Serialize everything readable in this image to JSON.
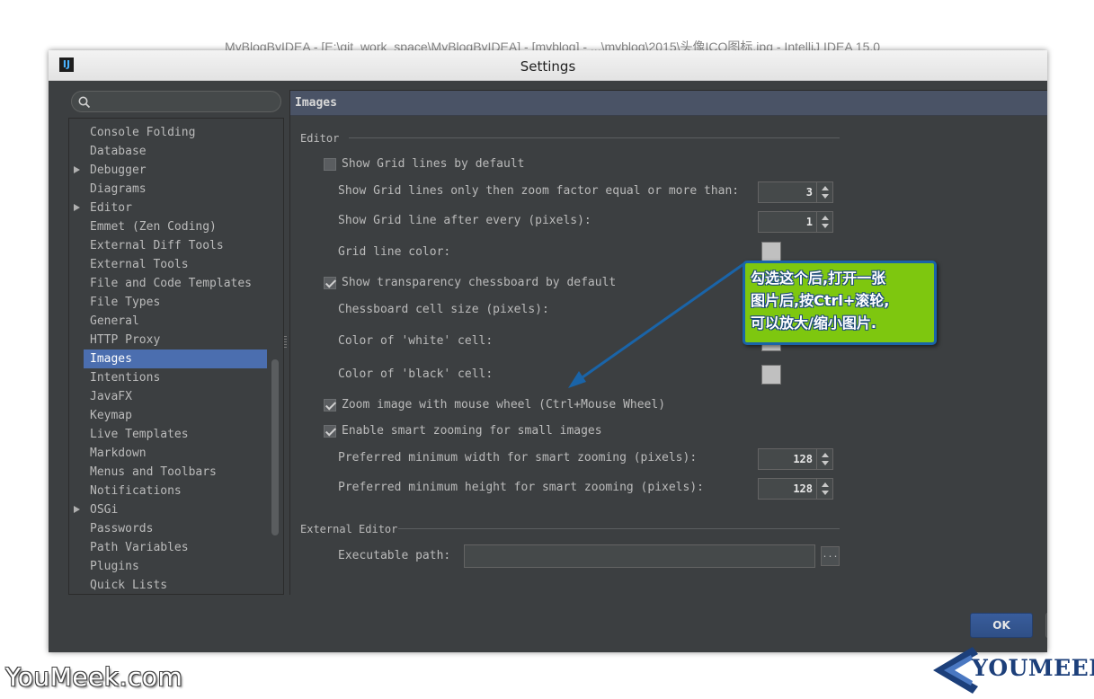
{
  "window_title": "Settings",
  "background_title": "MyBlogByIDEA - [E:\\git_work_space\\MyBlogByIDEA] - [myblog] - ...\\myblog\\2015\\头像ICO图标.jpg - IntelliJ IDEA 15.0",
  "app_icon": "IJ",
  "search": {
    "placeholder": "",
    "icon": "search-icon"
  },
  "sidebar": {
    "items": [
      {
        "label": "Console Folding",
        "expandable": false
      },
      {
        "label": "Database",
        "expandable": false
      },
      {
        "label": "Debugger",
        "expandable": true
      },
      {
        "label": "Diagrams",
        "expandable": false
      },
      {
        "label": "Editor",
        "expandable": true
      },
      {
        "label": "Emmet (Zen Coding)",
        "expandable": false
      },
      {
        "label": "External Diff Tools",
        "expandable": false
      },
      {
        "label": "External Tools",
        "expandable": false
      },
      {
        "label": "File and Code Templates",
        "expandable": false
      },
      {
        "label": "File Types",
        "expandable": false
      },
      {
        "label": "General",
        "expandable": false
      },
      {
        "label": "HTTP Proxy",
        "expandable": false
      },
      {
        "label": "Images",
        "expandable": false,
        "selected": true
      },
      {
        "label": "Intentions",
        "expandable": false
      },
      {
        "label": "JavaFX",
        "expandable": false
      },
      {
        "label": "Keymap",
        "expandable": false
      },
      {
        "label": "Live Templates",
        "expandable": false
      },
      {
        "label": "Markdown",
        "expandable": false
      },
      {
        "label": "Menus and Toolbars",
        "expandable": false
      },
      {
        "label": "Notifications",
        "expandable": false
      },
      {
        "label": "OSGi",
        "expandable": true
      },
      {
        "label": "Passwords",
        "expandable": false
      },
      {
        "label": "Path Variables",
        "expandable": false
      },
      {
        "label": "Plugins",
        "expandable": false
      },
      {
        "label": "Quick Lists",
        "expandable": false
      }
    ]
  },
  "panel": {
    "title": "Images",
    "editor_group": "Editor",
    "show_grid": {
      "label": "Show Grid lines by default",
      "checked": false
    },
    "grid_zoom": {
      "label": "Show Grid lines only then zoom factor equal or more than:",
      "value": "3"
    },
    "grid_every": {
      "label": "Show Grid line after every (pixels):",
      "value": "1"
    },
    "grid_color": {
      "label": "Grid line color:",
      "color": "#c0c0c0"
    },
    "show_chessboard": {
      "label": "Show transparency chessboard by default",
      "checked": true
    },
    "chess_size": {
      "label": "Chessboard cell size (pixels):"
    },
    "white_cell": {
      "label": "Color of 'white' cell:",
      "color": "#c0c0c0"
    },
    "black_cell": {
      "label": "Color of 'black' cell:",
      "color": "#c0c0c0"
    },
    "zoom_wheel": {
      "label": "Zoom image with mouse wheel (Ctrl+Mouse Wheel)",
      "checked": true
    },
    "smart_zoom": {
      "label": "Enable smart zooming for small images",
      "checked": true
    },
    "min_width": {
      "label": "Preferred minimum width for smart zooming (pixels):",
      "value": "128"
    },
    "min_height": {
      "label": "Preferred minimum height for smart zooming (pixels):",
      "value": "128"
    },
    "external_group": "External Editor",
    "exec_path": {
      "label": "Executable path:",
      "value": "",
      "browse_label": "..."
    }
  },
  "footer": {
    "ok_label": "OK"
  },
  "annotation": {
    "lines": [
      "勾选这个后,打开一张",
      "图片后,按Ctrl+滚轮,",
      "可以放大/缩小图片."
    ],
    "background": "#7ec70f",
    "border": "#1a64a8"
  },
  "watermark": {
    "left_text": "YouMeek.com",
    "logo_text": "YOUMEEK"
  },
  "colors": {
    "accent": "#4b6eaf",
    "panel_bg": "#3c3f41",
    "header_bg": "#4a5366"
  }
}
